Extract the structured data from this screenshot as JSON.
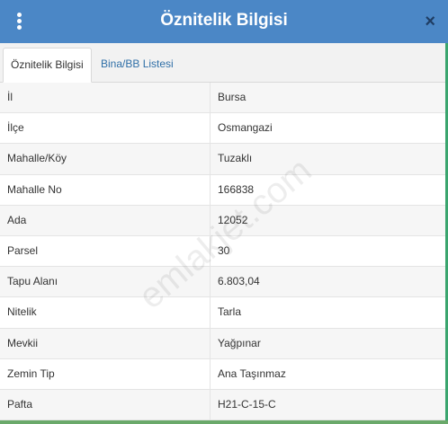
{
  "header": {
    "title": "Öznitelik Bilgisi",
    "menu_icon": "kebab-menu-icon",
    "close_icon": "close-icon",
    "close_glyph": "×",
    "bg_color": "#4b87c6"
  },
  "tabs": [
    {
      "label": "Öznitelik Bilgisi",
      "active": true
    },
    {
      "label": "Bina/BB Listesi",
      "active": false
    }
  ],
  "attributes": [
    {
      "key": "İl",
      "value": "Bursa"
    },
    {
      "key": "İlçe",
      "value": "Osmangazi"
    },
    {
      "key": "Mahalle/Köy",
      "value": "Tuzaklı"
    },
    {
      "key": "Mahalle No",
      "value": "166838"
    },
    {
      "key": "Ada",
      "value": "12052"
    },
    {
      "key": "Parsel",
      "value": "30"
    },
    {
      "key": "Tapu Alanı",
      "value": "6.803,04"
    },
    {
      "key": "Nitelik",
      "value": "Tarla"
    },
    {
      "key": "Mevkii",
      "value": "Yağpınar"
    },
    {
      "key": "Zemin Tip",
      "value": "Ana Taşınmaz"
    },
    {
      "key": "Pafta",
      "value": "H21-C-15-C"
    }
  ],
  "watermark": "emlakjet.com"
}
